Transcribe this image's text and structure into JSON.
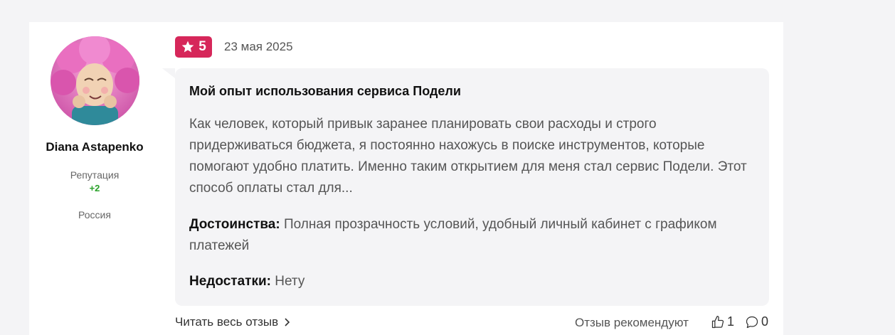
{
  "author": {
    "name": "Diana Astapenko",
    "reputation_label": "Репутация",
    "reputation_value": "+2",
    "country": "Россия",
    "avatar_icon": "avatar-pink-hair-doll"
  },
  "review": {
    "rating": "5",
    "date": "23 мая 2025",
    "title": "Мой опыт использования сервиса Подели",
    "body": "Как человек, который привык заранее планировать свои расходы и строго придерживаться бюджета, я постоянно нахожусь в поиске инструментов, которые помогают удобно платить. Именно таким открытием для меня стал сервис Подели. Этот способ оплаты стал для...",
    "pros_label": "Достоинства:",
    "pros_text": "Полная прозрачность условий, удобный личный кабинет с графиком платежей",
    "cons_label": "Недостатки:",
    "cons_text": "Нету"
  },
  "footer": {
    "read_more": "Читать весь отзыв",
    "recommend_label": "Отзыв рекомендуют",
    "likes": "1",
    "comments": "0"
  },
  "colors": {
    "accent": "#d6275a",
    "reputation_positive": "#2aa22a",
    "bubble_bg": "#f4f4f6"
  }
}
